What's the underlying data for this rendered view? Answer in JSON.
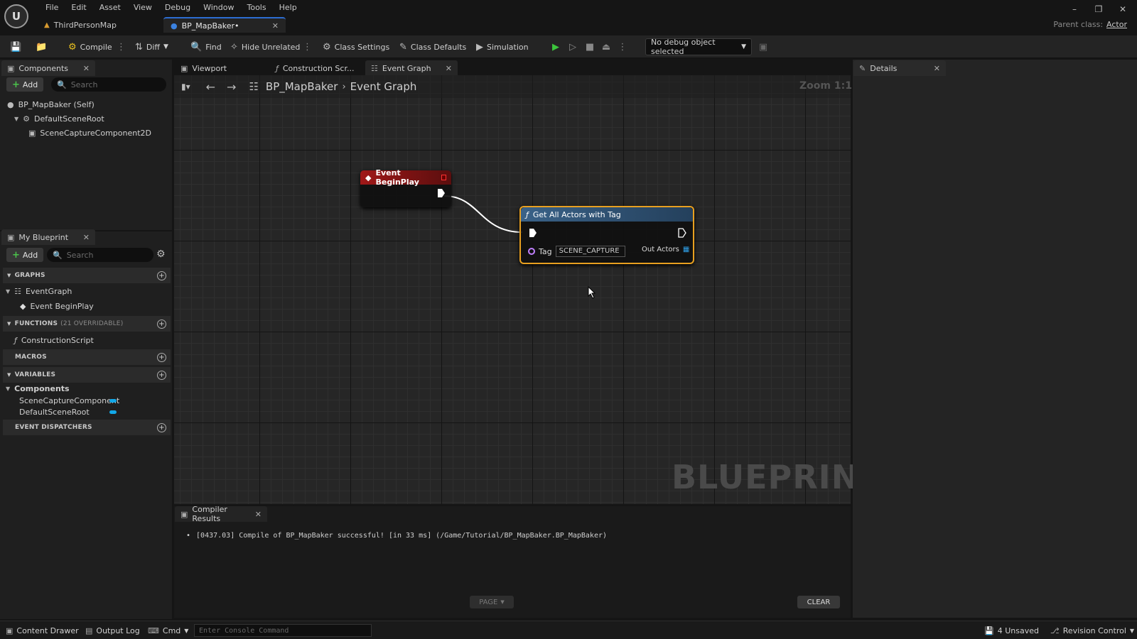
{
  "menu": [
    "File",
    "Edit",
    "Asset",
    "View",
    "Debug",
    "Window",
    "Tools",
    "Help"
  ],
  "logo_text": "U",
  "doc_tabs": [
    {
      "label": "ThirdPersonMap"
    },
    {
      "label": "BP_MapBaker•"
    }
  ],
  "parent_class": {
    "label": "Parent class:",
    "value": "Actor"
  },
  "toolbar": {
    "compile": "Compile",
    "diff": "Diff",
    "find": "Find",
    "hide_unrelated": "Hide Unrelated",
    "class_settings": "Class Settings",
    "class_defaults": "Class Defaults",
    "simulation": "Simulation",
    "debug_object": "No debug object selected"
  },
  "components_panel": {
    "title": "Components",
    "add": "Add",
    "search_placeholder": "Search",
    "tree": [
      "BP_MapBaker (Self)",
      "DefaultSceneRoot",
      "SceneCaptureComponent2D"
    ]
  },
  "my_blueprint": {
    "title": "My Blueprint",
    "add": "Add",
    "search_placeholder": "Search",
    "sections": {
      "graphs": "GRAPHS",
      "functions": "FUNCTIONS",
      "functions_sub": "(21 OVERRIDABLE)",
      "macros": "MACROS",
      "variables": "VARIABLES",
      "event_dispatchers": "EVENT DISPATCHERS"
    },
    "graph_items": [
      "EventGraph",
      "Event BeginPlay"
    ],
    "function_items": [
      "ConstructionScript"
    ],
    "variable_category": "Components",
    "variables": [
      "SceneCaptureComponent",
      "DefaultSceneRoot"
    ],
    "var_color": "#12a8e8"
  },
  "editor_tabs": [
    "Viewport",
    "Construction Scr...",
    "Event Graph"
  ],
  "breadcrumb": {
    "root": "BP_MapBaker",
    "current": "Event Graph"
  },
  "zoom": "Zoom 1:1",
  "watermark": "BLUEPRINT",
  "nodes": {
    "begin_play": {
      "title": "Event BeginPlay",
      "color": "#8a1515"
    },
    "get_actors": {
      "title": "Get All Actors with Tag",
      "pin_tag": "Tag",
      "tag_value": "SCENE_CAPTURE",
      "pin_out": "Out Actors",
      "color": "#2c4a6a",
      "highlight": "#e8a020"
    }
  },
  "compiler": {
    "title": "Compiler Results",
    "messages": [
      "[0437.03] Compile of BP_MapBaker successful! [in 33 ms] (/Game/Tutorial/BP_MapBaker.BP_MapBaker)"
    ],
    "page": "PAGE",
    "clear": "CLEAR"
  },
  "details": {
    "title": "Details"
  },
  "statusbar": {
    "content_drawer": "Content Drawer",
    "output_log": "Output Log",
    "cmd": "Cmd",
    "console_placeholder": "Enter Console Command",
    "unsaved": "4 Unsaved",
    "revision_control": "Revision Control"
  }
}
